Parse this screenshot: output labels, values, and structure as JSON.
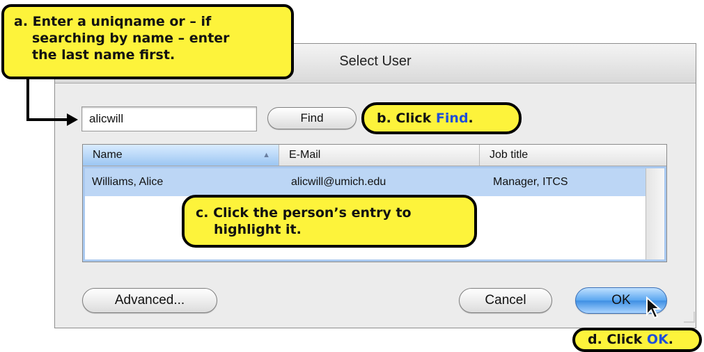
{
  "dialog": {
    "title": "Select User",
    "search": {
      "value": "alicwill"
    },
    "find_label": "Find",
    "table": {
      "columns": [
        "Name",
        "E-Mail",
        "Job title"
      ],
      "rows": [
        {
          "name": "Williams, Alice",
          "email": "alicwill@umich.edu",
          "job": "Manager, ITCS"
        }
      ]
    },
    "buttons": {
      "advanced": "Advanced...",
      "cancel": "Cancel",
      "ok": "OK"
    }
  },
  "callouts": {
    "a": {
      "line1": "a.  Enter a uniqname or – if",
      "line2": "searching by name – enter",
      "line3": "the last name first."
    },
    "b": {
      "prefix": "b.  Click ",
      "highlight": "Find",
      "suffix": "."
    },
    "c": {
      "line1": "c.  Click the person’s entry to",
      "line2": "highlight it."
    },
    "d": {
      "prefix": "d.  Click ",
      "highlight": "OK",
      "suffix": "."
    }
  },
  "colors": {
    "callout_fill": "#fdf33b",
    "highlight_text": "#1f4fd8",
    "ok_button": "#3e8fe3",
    "selected_row": "#bcd6f5"
  }
}
